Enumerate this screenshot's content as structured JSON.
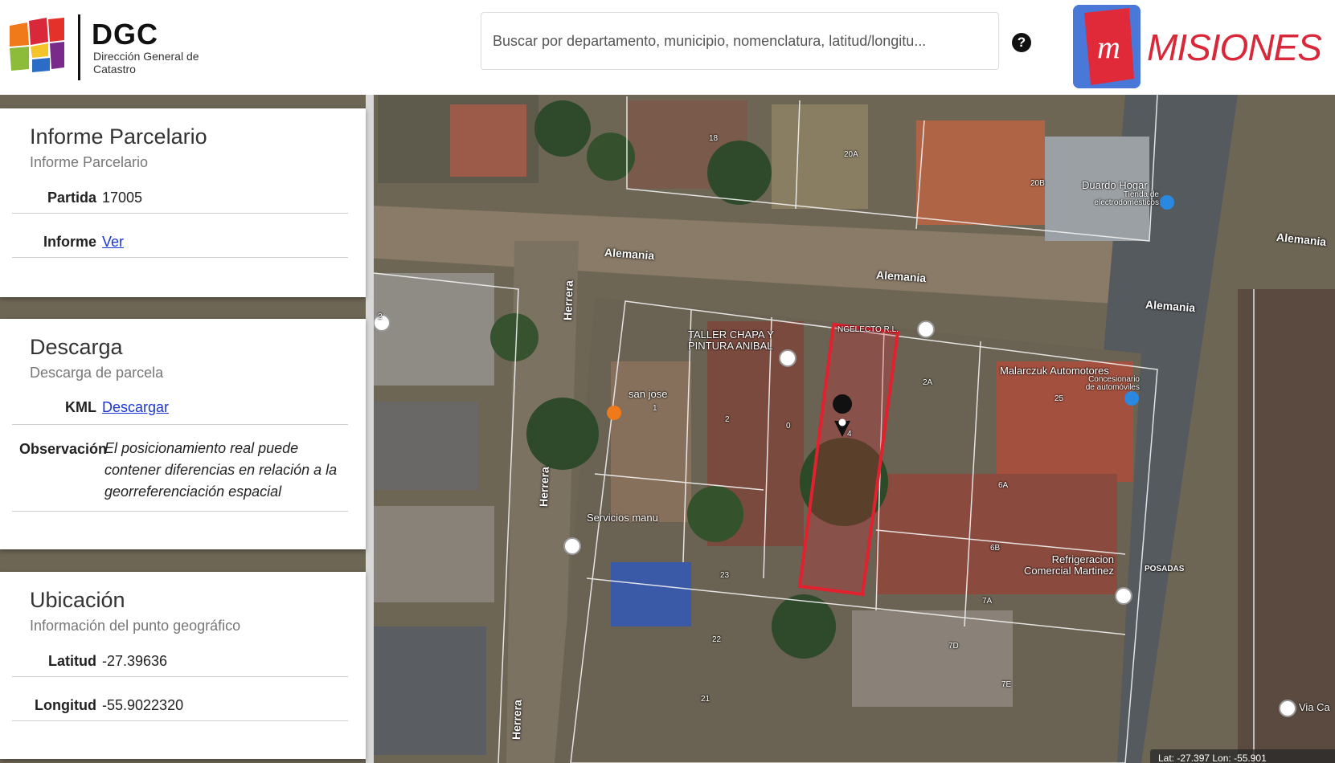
{
  "header": {
    "logo_title": "DGC",
    "logo_subtitle": "Dirección General de Catastro",
    "search_placeholder": "Buscar por departamento, municipio, nomenclatura, latitud/longitu...",
    "help_label": "?",
    "brand_text": "MISIONES",
    "brand_mark": "m"
  },
  "panels": {
    "informe": {
      "title": "Informe Parcelario",
      "subtitle": "Informe Parcelario",
      "rows": [
        {
          "key": "Partida",
          "value": "17005"
        },
        {
          "key": "Informe",
          "value": "Ver"
        }
      ]
    },
    "descarga": {
      "title": "Descarga",
      "subtitle": "Descarga de parcela",
      "rows": [
        {
          "key": "KML",
          "value": "Descargar"
        },
        {
          "key": "Observación",
          "value": "El posicionamiento real puede contener diferencias en relación a la georreferenciación espacial"
        }
      ]
    },
    "ubicacion": {
      "title": "Ubicación",
      "subtitle": "Información del punto geográfico",
      "rows": [
        {
          "key": "Latitud",
          "value": "-27.39636"
        },
        {
          "key": "Longitud",
          "value": "-55.9022320"
        }
      ]
    }
  },
  "map": {
    "streets": [
      "Alemania",
      "Alemania",
      "Alemania",
      "Alemania",
      "Herrera",
      "Herrera",
      "Herrera",
      "POSADAS"
    ],
    "pois": [
      "Duardo Hogar",
      "Tienda de electrodomésticos",
      "TALLER CHAPA Y PINTURA ANIBAL",
      "NGELECTO R.L.",
      "Malarczuk Automotores",
      "Concesionario de automóviles",
      "san jose",
      "Servicios manu",
      "Refrigeracion Comercial Martinez",
      "Via Ca"
    ],
    "parcel_numbers": [
      "18",
      "20A",
      "20B",
      "2",
      "0",
      "4",
      "2A",
      "25",
      "6A",
      "6B",
      "7A",
      "7D",
      "7E",
      "23",
      "22",
      "21",
      "1",
      "2"
    ],
    "highlight_color": "#e3202e",
    "coord_readout": "Lat: -27.397 Lon: -55.901"
  }
}
